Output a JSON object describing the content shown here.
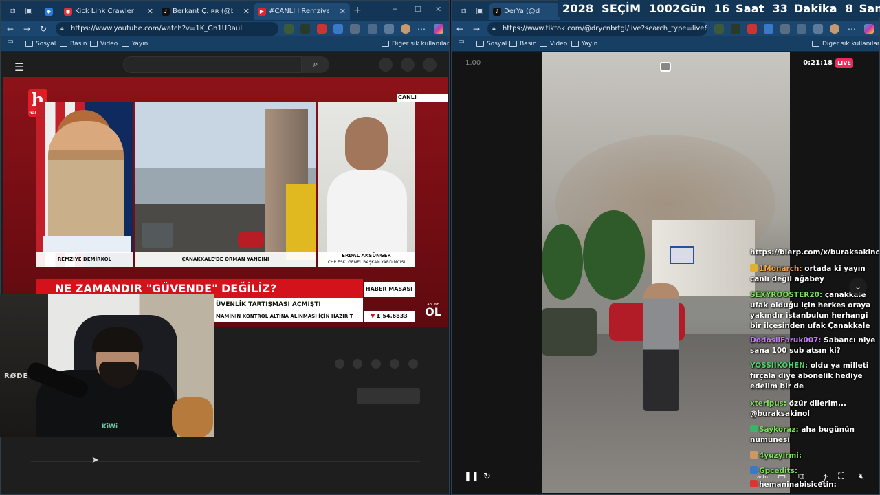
{
  "left_browser": {
    "tabs": [
      {
        "label": "",
        "favicon_color": "#2b7bd8",
        "active": false
      },
      {
        "label": "Kick Link Crawler",
        "favicon_color": "#d6343b",
        "active": false
      },
      {
        "label": "Berkant Ç. ʀʀ (@berko_oo) ·",
        "favicon_color": "#111111",
        "active": false
      },
      {
        "label": "#CANLI l Remziye Demirkol",
        "favicon_color": "#e0242b",
        "active": true
      }
    ],
    "new_tab_glyph": "+",
    "url": "https://www.youtube.com/watch?v=1K_Gh1URauI",
    "bookmarks": [
      "Sosyal",
      "Basın",
      "Video",
      "Yayın"
    ],
    "other_bookmarks": "Diğer sık kullanılanlar"
  },
  "youtube": {
    "search_placeholder": "",
    "broadcast": {
      "logo_letter": "h",
      "logo_sub": "halk TV",
      "live_tag": "CANLI",
      "caption_left": "REMZİYE DEMİRKOL",
      "caption_center": "ÇANAKKALE'DE ORMAN YANGINI",
      "caption_right_name": "ERDAL AKSÜNGER",
      "caption_right_title": "CHP ESKİ GENEL BAŞKAN YARDIMCISI",
      "headline": "NE ZAMANDIR \"GÜVENDE\" DEĞİLİZ?",
      "program": "HABER MASASI",
      "subheadline": "ÜVENLİK TARTIŞMASI AÇMIŞTI",
      "ticker": "MAMININ KONTROL ALTINA ALINMASI İÇİN HAZIR T",
      "fx_value": "£ 54.6833",
      "subscribe_top": "ABONE",
      "subscribe_bottom": "OL"
    },
    "webcam": {
      "mic_brand": "RØDE",
      "shirt_logo": "KiWi"
    }
  },
  "right_browser": {
    "tabs": [
      {
        "label": "DerYa (@drycnbrtgl) C",
        "favicon_color": "#111111",
        "active": true
      }
    ],
    "url": "https://www.tiktok.com/@drycnbrtgl/live?search_type=live&sea...",
    "bookmarks": [
      "Sosyal",
      "Basın",
      "Video",
      "Yayın"
    ],
    "other_bookmarks": "Diğer sık kullanılanlar"
  },
  "tiktok": {
    "speed": "1.00",
    "elapsed": "0:21:18",
    "live_badge": "LIVE",
    "chat": [
      {
        "user": "",
        "text": "https://bierp.com/x/buraksakinol",
        "user_color": "#ffffff"
      },
      {
        "user": "1Monarch:",
        "text": "ortada ki yayın canlı değil ağabey",
        "user_color": "#f2a23a"
      },
      {
        "user": "SEXYROOSTER20:",
        "text": "çanakkale ufak olduğu için herkes oraya yakındır istanbulun herhangi bir ilçesinden ufak Çanakkale",
        "user_color": "#7be05a"
      },
      {
        "user": "DodosilFaruk007:",
        "text": "Sabancı niye sana 100 sub atsın ki?",
        "user_color": "#c07cf0"
      },
      {
        "user": "YOSSIIKOHEN:",
        "text": "oldu ya milleti fırçala diye abonelik hediye edelim bir de",
        "user_color": "#4fd36a"
      },
      {
        "user": "xteripus:",
        "text": "özür dilerim... @buraksakinol",
        "user_color": "#7be05a"
      },
      {
        "user": "Saykoraz:",
        "text": "aha bugünün numunesi",
        "user_color": "#7be05a"
      },
      {
        "user": "4yuzyirmi:",
        "text": "",
        "user_color": "#7be05a"
      },
      {
        "user": "Gpcedits:",
        "text": "",
        "user_color": "#7be05a"
      },
      {
        "user": "hemaninabisicetin:",
        "text": "",
        "user_color": "#ffffff"
      }
    ],
    "auto_label": "auto"
  },
  "countdown": {
    "year": "2028",
    "label": "SEÇİM",
    "days": "1002",
    "days_unit": "Gün",
    "hours": "16",
    "hours_unit": "Saat",
    "minutes": "33",
    "minutes_unit": "Dakika",
    "seconds": "8",
    "seconds_unit": "Saniye"
  },
  "colors": {
    "tab_bar": "#143656",
    "nav_bar": "#1b466f",
    "headline_red": "#d3121b",
    "live_pink": "#f0285c"
  }
}
